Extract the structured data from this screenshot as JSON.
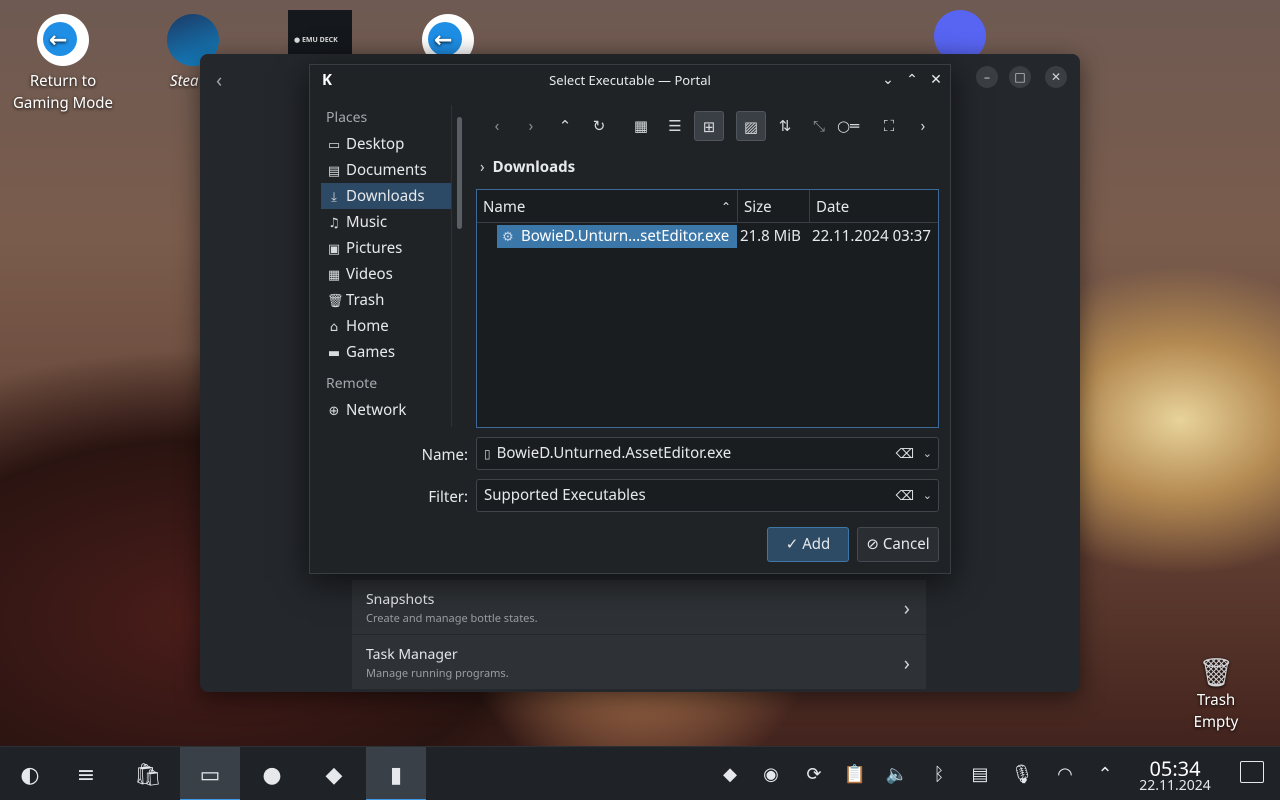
{
  "desktop": {
    "icons": [
      {
        "label": "Return to Gaming Mode"
      },
      {
        "label": "Stea"
      },
      {
        "label": "EMU DECK"
      },
      {
        "label": "Trash"
      },
      {
        "label": "Empty"
      }
    ]
  },
  "app": {
    "rows": [
      {
        "title": "Snapshots",
        "subtitle": "Create and manage bottle states."
      },
      {
        "title": "Task Manager",
        "subtitle": "Manage running programs."
      }
    ]
  },
  "dialog": {
    "title": "Select Executable — Portal",
    "places_header": "Places",
    "places": [
      {
        "label": "Desktop",
        "icon": "desktop-icon"
      },
      {
        "label": "Documents",
        "icon": "documents-icon"
      },
      {
        "label": "Downloads",
        "icon": "downloads-icon",
        "active": true
      },
      {
        "label": "Music",
        "icon": "music-icon"
      },
      {
        "label": "Pictures",
        "icon": "pictures-icon"
      },
      {
        "label": "Videos",
        "icon": "videos-icon"
      },
      {
        "label": "Trash",
        "icon": "trash-icon"
      },
      {
        "label": "Home",
        "icon": "home-icon"
      },
      {
        "label": "Games",
        "icon": "folder-icon"
      }
    ],
    "remote_header": "Remote",
    "remote": [
      {
        "label": "Network",
        "icon": "network-icon"
      }
    ],
    "breadcrumb": "Downloads",
    "columns": {
      "name": "Name",
      "size": "Size",
      "date": "Date"
    },
    "files": [
      {
        "name": "BowieD.Unturn...setEditor.exe",
        "size": "21.8 MiB",
        "date": "22.11.2024 03:37",
        "selected": true
      }
    ],
    "name_label": "Name:",
    "name_value": "BowieD.Unturned.AssetEditor.exe",
    "filter_label": "Filter:",
    "filter_value": "Supported Executables",
    "add_label": "Add",
    "cancel_label": "Cancel"
  },
  "taskbar": {
    "time": "05:34",
    "date": "22.11.2024"
  },
  "colors": {
    "accent": "#3c77aa",
    "selection": "#2c4a65",
    "dialog_bg": "#202326"
  }
}
